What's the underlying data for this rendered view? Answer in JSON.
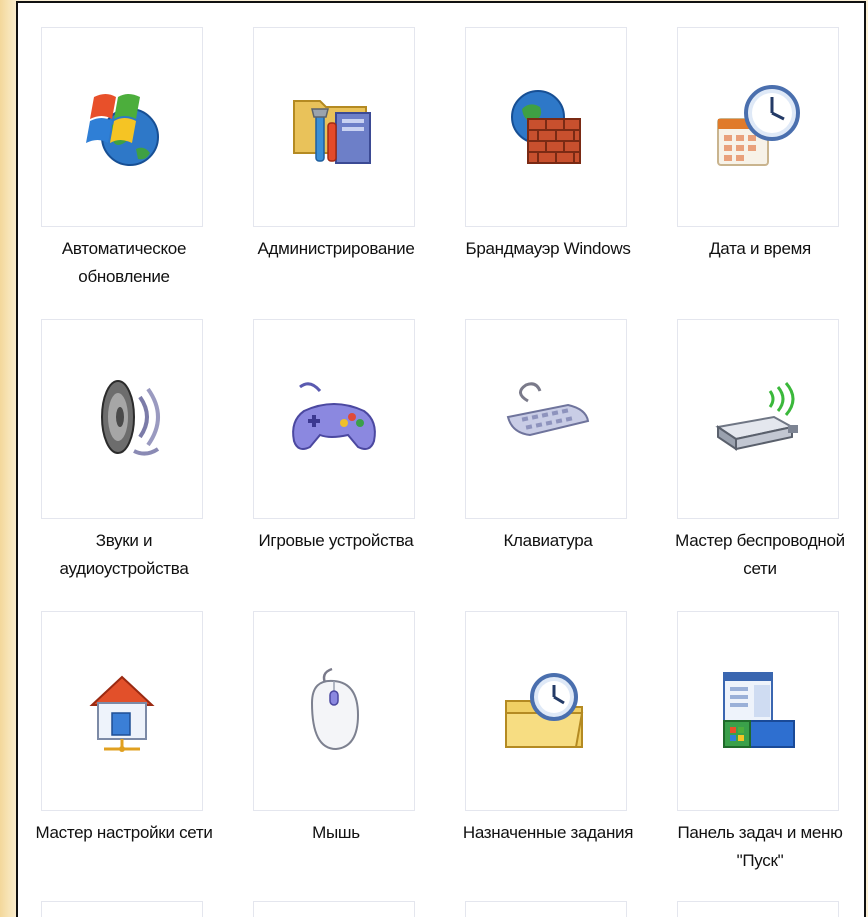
{
  "items": [
    {
      "icon": "windows-update-icon",
      "line1": "Автоматическое",
      "line2": "обновление"
    },
    {
      "icon": "administrative-tools-icon",
      "line1": "Администрирование",
      "line2": ""
    },
    {
      "icon": "windows-firewall-icon",
      "line1": "Брандмауэр Windows",
      "line2": ""
    },
    {
      "icon": "date-time-icon",
      "line1": "Дата и время",
      "line2": ""
    },
    {
      "icon": "sounds-speaker-icon",
      "line1": "Звуки и",
      "line2": "аудиоустройства"
    },
    {
      "icon": "game-controller-icon",
      "line1": "Игровые устройства",
      "line2": ""
    },
    {
      "icon": "keyboard-icon",
      "line1": "Клавиатура",
      "line2": ""
    },
    {
      "icon": "wireless-network-icon",
      "line1": "Мастер беспроводной",
      "line2": "сети"
    },
    {
      "icon": "network-setup-house-icon",
      "line1": "Мастер настройки сети",
      "line2": ""
    },
    {
      "icon": "mouse-icon",
      "line1": "Мышь",
      "line2": ""
    },
    {
      "icon": "scheduled-tasks-icon",
      "line1": "Назначенные задания",
      "line2": ""
    },
    {
      "icon": "taskbar-start-menu-icon",
      "line1": "Панель задач и меню",
      "line2": "\"Пуск\""
    }
  ]
}
